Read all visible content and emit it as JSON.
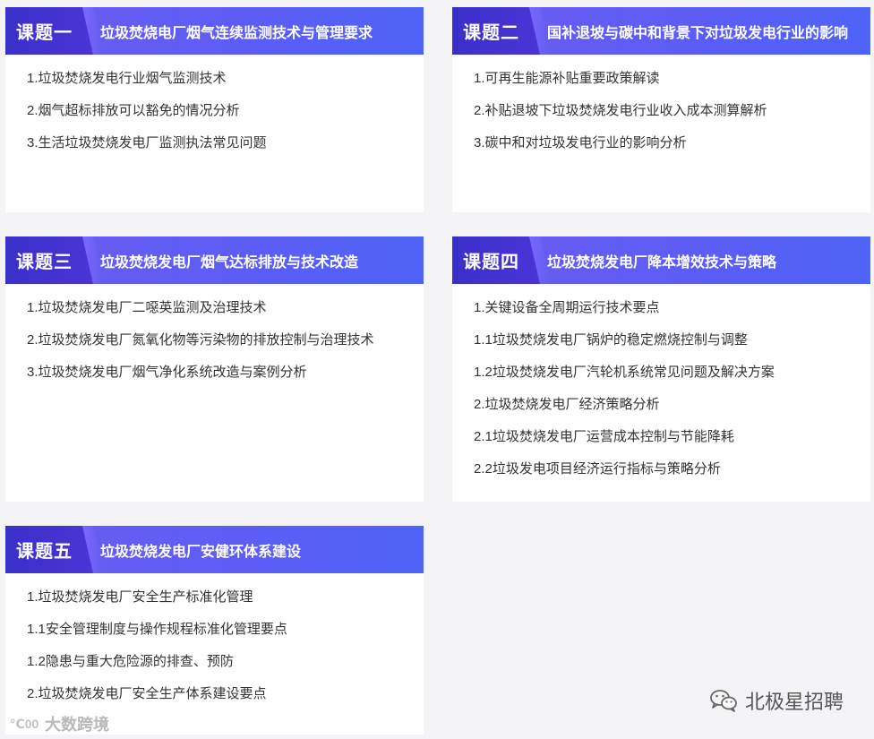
{
  "cards": [
    {
      "badge": "课题一",
      "title": "垃圾焚烧电厂烟气连续监测技术与管理要求",
      "items": [
        "1.垃圾焚烧发电行业烟气监测技术",
        "2.烟气超标排放可以豁免的情况分析",
        "3.生活垃圾焚烧发电厂监测执法常见问题"
      ]
    },
    {
      "badge": "课题二",
      "title": "国补退坡与碳中和背景下对垃圾发电行业的影响",
      "items": [
        "1.可再生能源补贴重要政策解读",
        "2.补贴退坡下垃圾焚烧发电行业收入成本测算解析",
        "3.碳中和对垃圾发电行业的影响分析"
      ]
    },
    {
      "badge": "课题三",
      "title": "垃圾焚烧发电厂烟气达标排放与技术改造",
      "items": [
        "1.垃圾焚烧发电厂二噁英监测及治理技术",
        "2.垃圾焚烧发电厂氮氧化物等污染物的排放控制与治理技术",
        "3.垃圾焚烧发电厂烟气净化系统改造与案例分析"
      ]
    },
    {
      "badge": "课题四",
      "title": "垃圾焚烧发电厂降本增效技术与策略",
      "items": [
        "1.关键设备全周期运行技术要点",
        "1.1垃圾焚烧发电厂锅炉的稳定燃烧控制与调整",
        "1.2垃圾焚烧发电厂汽轮机系统常见问题及解决方案",
        "2.垃圾焚烧发电厂经济策略分析",
        "2.1垃圾焚烧发电厂运营成本控制与节能降耗",
        "2.2垃圾发电项目经济运行指标与策略分析"
      ]
    },
    {
      "badge": "课题五",
      "title": "垃圾焚烧发电厂安健环体系建设",
      "items": [
        "1.垃圾焚烧发电厂安全生产标准化管理",
        "1.1安全管理制度与操作规程标准化管理要点",
        "1.2隐患与重大危险源的排查、预防",
        "2.垃圾焚烧发电厂安全生产体系建设要点"
      ]
    }
  ],
  "watermark_left": {
    "icon_text": "℃00",
    "text": "大数跨境"
  },
  "watermark_right": {
    "icon": "wechat-icon",
    "text": "北极星招聘"
  },
  "colors": {
    "header": "#5b5df5",
    "badge": "#3a2fc9",
    "background": "#f4f4f6"
  }
}
